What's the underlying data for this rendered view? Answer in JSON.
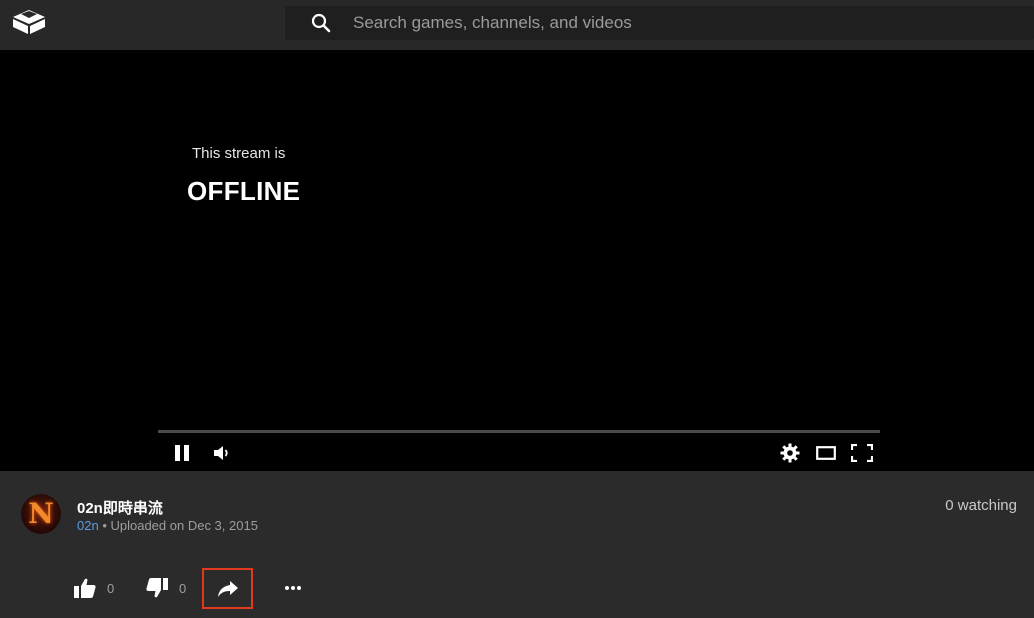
{
  "header": {
    "logo_icon": "box-logo-icon",
    "search": {
      "icon": "search-icon",
      "placeholder": "Search games, channels, and videos",
      "value": ""
    }
  },
  "player": {
    "status_pre": "This stream is",
    "status_main": "OFFLINE",
    "controls": {
      "play_state_icon": "pause-icon",
      "volume_icon": "volume-icon",
      "settings_icon": "gear-icon",
      "theater_icon": "theater-mode-icon",
      "fullscreen_icon": "fullscreen-icon"
    }
  },
  "stream": {
    "title": "02n即時串流",
    "channel": "02n",
    "separator": " • ",
    "upload_text": "Uploaded on Dec 3, 2015",
    "watching": "0 watching",
    "avatar_letter": "N"
  },
  "actions": {
    "likes": "0",
    "dislikes": "0",
    "share_icon": "share-icon",
    "more_icon": "more-dots-icon"
  },
  "colors": {
    "accent_link": "#5b9ae0",
    "highlight_border": "#e23a1e",
    "player_bg": "#000000",
    "page_bg": "#2b2b2b"
  }
}
